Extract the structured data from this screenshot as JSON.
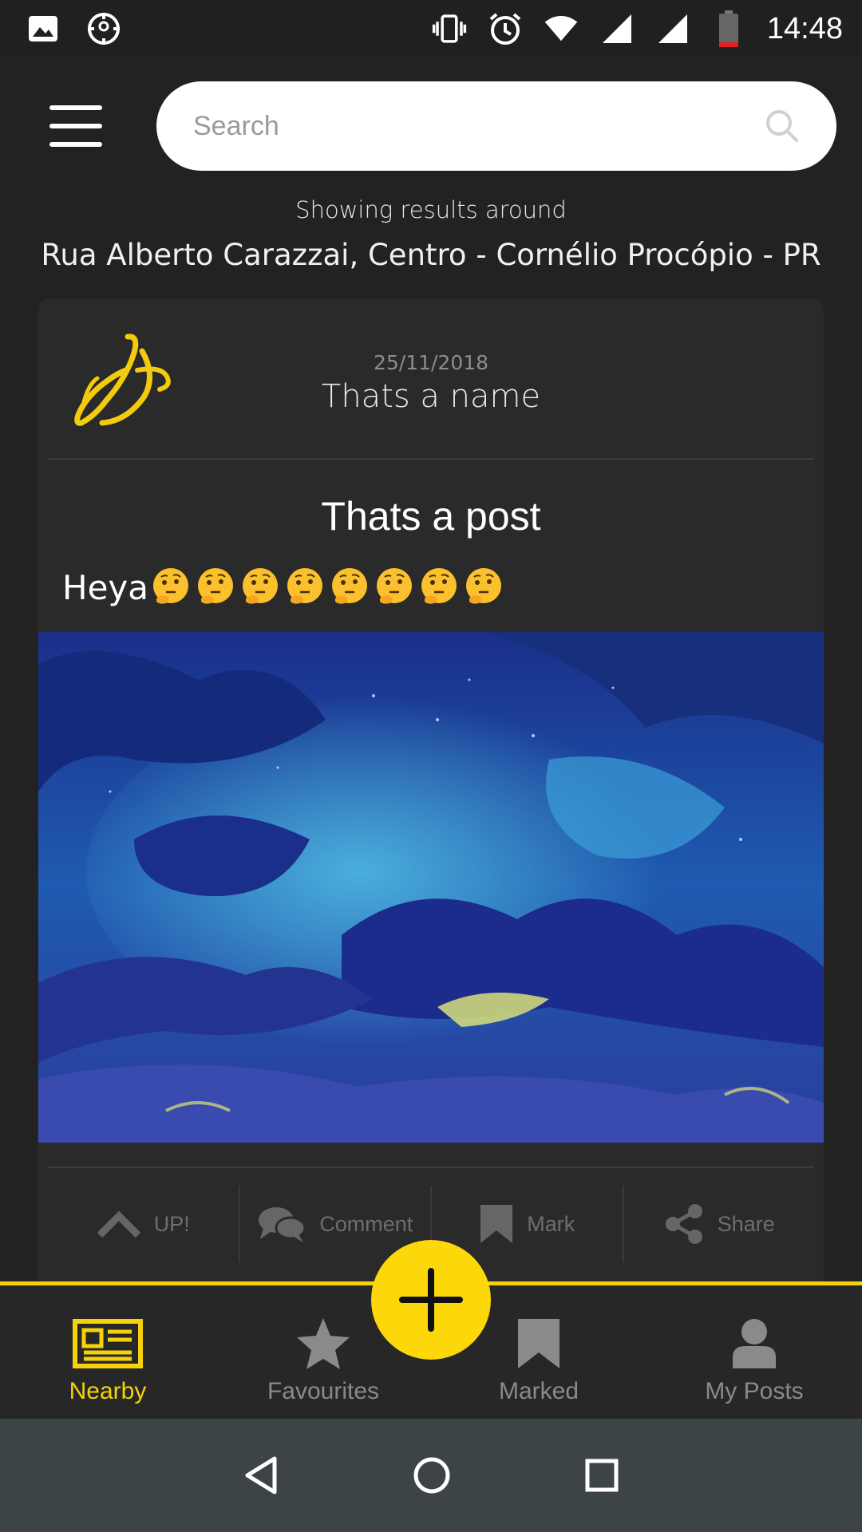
{
  "status_bar": {
    "time": "14:48"
  },
  "search": {
    "placeholder": "Search"
  },
  "location": {
    "caption": "Showing results around",
    "address": "Rua Alberto Carazzai, Centro - Cornélio Procópio - PR"
  },
  "post": {
    "date": "25/11/2018",
    "author": "Thats a name",
    "title": "Thats a post",
    "body_text": "Heya",
    "emoji": [
      "🤔",
      "🤔",
      "🤔",
      "🤔",
      "🤔",
      "🤔",
      "🤔",
      "🤔"
    ],
    "actions": {
      "up": "UP!",
      "comment": "Comment",
      "mark": "Mark",
      "share": "Share"
    }
  },
  "bottom_nav": {
    "items": [
      {
        "label": "Nearby",
        "icon": "newspaper-icon",
        "active": true
      },
      {
        "label": "Favourites",
        "icon": "star-icon"
      },
      {
        "label": "Marked",
        "icon": "bookmark-icon"
      },
      {
        "label": "My Posts",
        "icon": "person-icon"
      }
    ]
  },
  "colors": {
    "accent": "#f5d20a",
    "background": "#222222",
    "card": "#2a2a2a"
  }
}
